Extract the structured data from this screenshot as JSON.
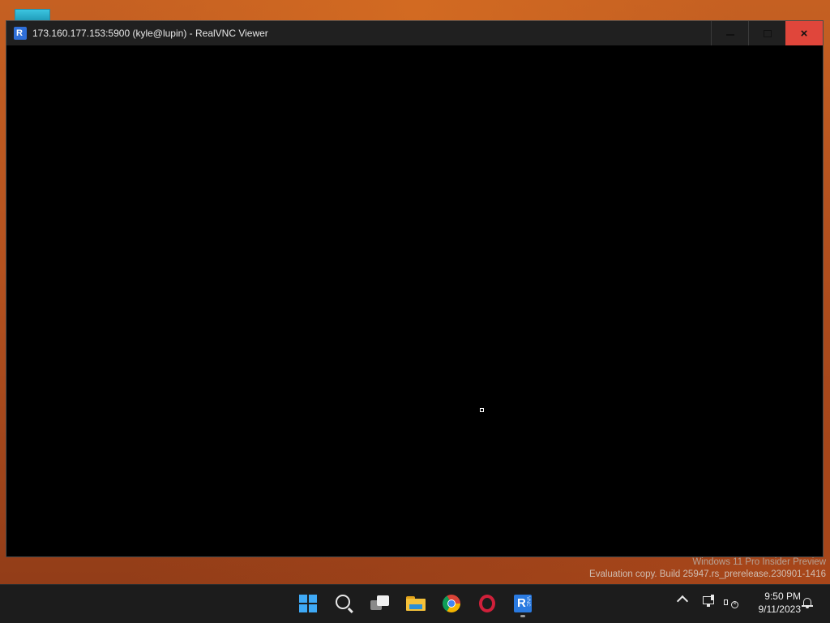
{
  "window": {
    "title": "173.160.177.153:5900 (kyle@lupin) - RealVNC Viewer",
    "app_icon": "realvnc-icon",
    "controls": {
      "minimize": "minimize-icon",
      "maximize": "maximize-icon",
      "close": "×"
    },
    "accent_close": "#e0463b"
  },
  "watermark": {
    "line1": "Windows 11 Pro Insider Preview",
    "line2": "Evaluation copy. Build 25947.rs_prerelease.230901-1416"
  },
  "taskbar": {
    "pinned": [
      {
        "name": "start-icon"
      },
      {
        "name": "search-icon"
      },
      {
        "name": "task-view-icon"
      },
      {
        "name": "file-explorer-icon"
      },
      {
        "name": "chrome-icon"
      },
      {
        "name": "opera-icon"
      },
      {
        "name": "realvnc-viewer-icon",
        "running": true,
        "glyph": "R",
        "sub": "VNC"
      }
    ],
    "tray": {
      "chevron": "show-hidden-icons",
      "network": "network-icon",
      "volume": "volume-muted-icon",
      "time": "9:50 PM",
      "date": "9/11/2023",
      "notifications": "bell-icon"
    }
  }
}
